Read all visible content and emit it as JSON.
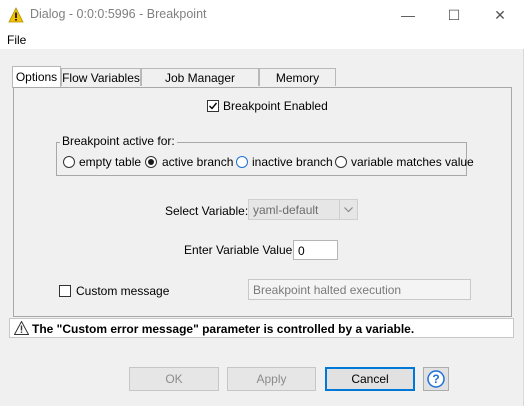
{
  "window": {
    "title": "Dialog - 0:0:0:5996 - Breakpoint",
    "minimize_glyph": "—",
    "maximize_glyph": "☐",
    "close_glyph": "✕"
  },
  "menu": {
    "file": "File"
  },
  "tabs": [
    {
      "label": "Options",
      "active": true
    },
    {
      "label": "Flow Variables",
      "active": false
    },
    {
      "label": "Job Manager Selection",
      "active": false
    },
    {
      "label": "Memory Policy",
      "active": false
    }
  ],
  "options": {
    "breakpoint_enabled_label": "Breakpoint Enabled",
    "breakpoint_enabled_checked": true,
    "active_for_title": "Breakpoint active for:",
    "radios": [
      {
        "label": "empty table",
        "selected": false
      },
      {
        "label": "active branch",
        "selected": true
      },
      {
        "label": "inactive branch",
        "selected": false
      },
      {
        "label": "variable matches value",
        "selected": false
      }
    ],
    "select_variable_label": "Select Variable:",
    "select_variable_value": "yaml-default",
    "enter_value_label": "Enter Variable Value:",
    "enter_value_value": "0",
    "custom_message_label": "Custom message",
    "custom_message_checked": false,
    "custom_message_value": "Breakpoint halted execution"
  },
  "warning": {
    "text": "The \"Custom error message\" parameter is controlled by a variable."
  },
  "buttons": {
    "ok": "OK",
    "apply": "Apply",
    "cancel": "Cancel",
    "help_glyph": "?"
  },
  "colors": {
    "title_icon": "#f2c200",
    "focus_blue": "#0078d7",
    "help_blue": "#1e6fd9"
  }
}
